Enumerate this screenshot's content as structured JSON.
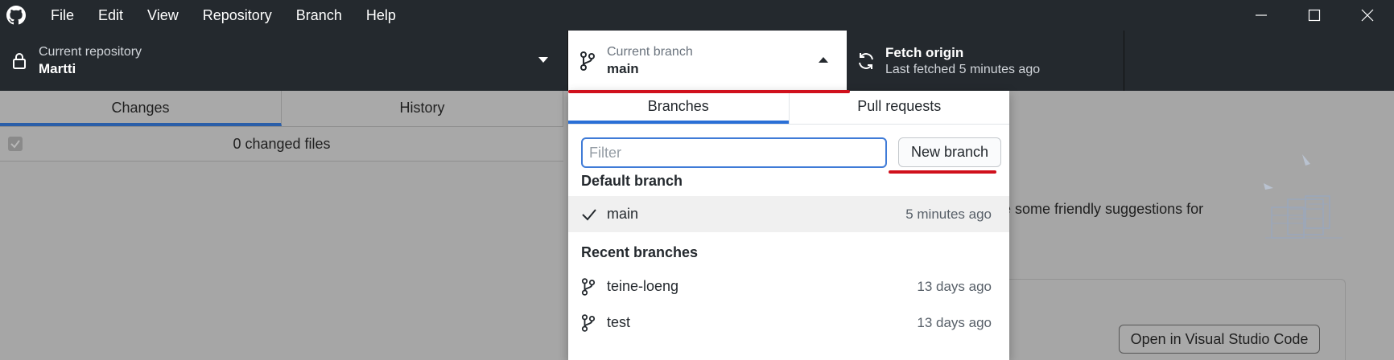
{
  "menu": [
    "File",
    "Edit",
    "View",
    "Repository",
    "Branch",
    "Help"
  ],
  "toolbar": {
    "repo_label": "Current repository",
    "repo_value": "Martti",
    "branch_label": "Current branch",
    "branch_value": "main",
    "fetch_title": "Fetch origin",
    "fetch_sub": "Last fetched 5 minutes ago"
  },
  "left": {
    "tab_changes": "Changes",
    "tab_history": "History",
    "changed_files": "0 changed files"
  },
  "right": {
    "suggestions_fragment": "re some friendly suggestions for",
    "open_vscode": "Open in Visual Studio Code"
  },
  "dropdown": {
    "tab_branches": "Branches",
    "tab_pulls": "Pull requests",
    "filter_placeholder": "Filter",
    "new_branch": "New branch",
    "default_header": "Default branch",
    "recent_header": "Recent branches",
    "default_branches": [
      {
        "name": "main",
        "time": "5 minutes ago"
      }
    ],
    "recent_branches": [
      {
        "name": "teine-loeng",
        "time": "13 days ago"
      },
      {
        "name": "test",
        "time": "13 days ago"
      }
    ]
  },
  "colors": {
    "titlebar": "#24292e",
    "accent_blue": "#2a6fd6",
    "annotation_red": "#d0101c"
  }
}
